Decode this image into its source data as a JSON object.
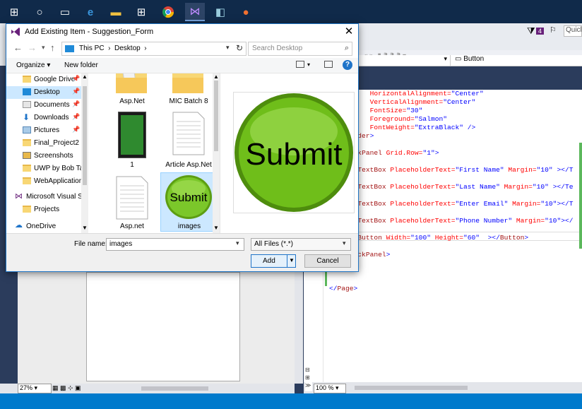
{
  "dialog": {
    "title": "Add Existing Item - Suggestion_Form",
    "close": "✕",
    "address": {
      "segments": "This PC  ›  Desktop  ›"
    },
    "search_placeholder": "Search Desktop",
    "toolbar": {
      "organize": "Organize ▾",
      "new_folder": "New folder",
      "help": "?"
    },
    "nav_items": [
      {
        "label": "Google Drive",
        "pin": "📌"
      },
      {
        "label": "Desktop",
        "pin": "📌"
      },
      {
        "label": "Documents",
        "pin": "📌"
      },
      {
        "label": "Downloads",
        "pin": "📌"
      },
      {
        "label": "Pictures",
        "pin": "📌"
      },
      {
        "label": "Final_Project2"
      },
      {
        "label": "Screenshots"
      },
      {
        "label": "UWP by Bob Tab"
      },
      {
        "label": "WebApplication"
      },
      {
        "label": "Microsoft Visual S"
      },
      {
        "label": "Projects"
      },
      {
        "label": "OneDrive"
      }
    ],
    "files": [
      {
        "name": "Asp.Net"
      },
      {
        "name": "MIC Batch 8"
      },
      {
        "name": "1"
      },
      {
        "name": "Article Asp.Net"
      },
      {
        "name": "Asp.net"
      },
      {
        "name": "images"
      }
    ],
    "thumb_text": "Submit",
    "preview_text": "Submit",
    "filename_label": "File name:",
    "filename_value": "images",
    "filetype_value": "All Files (*.*)",
    "add_label": "Add",
    "cancel_label": "Cancel"
  },
  "editor": {
    "dropdown_right": "Button",
    "quick": "Quick",
    "badge": "4",
    "zoom_left": "27%",
    "zoom_right": "100 %",
    "lines": [
      {
        "indent": "          ",
        "parts": [
          [
            "attr",
            "HorizontalAlignment="
          ],
          [
            "val",
            "\"Center\""
          ]
        ]
      },
      {
        "indent": "          ",
        "parts": [
          [
            "attr",
            "VerticalAlignment="
          ],
          [
            "val",
            "\"Center\""
          ]
        ]
      },
      {
        "indent": "          ",
        "parts": [
          [
            "attr",
            "FontSize="
          ],
          [
            "val",
            "\"30\""
          ]
        ]
      },
      {
        "indent": "          ",
        "parts": [
          [
            "attr",
            "Foreground="
          ],
          [
            "val",
            "\"Salmon\""
          ]
        ]
      },
      {
        "indent": "          ",
        "parts": [
          [
            "attr",
            "FontWeight="
          ],
          [
            "val",
            "\"ExtraBlack\""
          ],
          [
            "br",
            " />"
          ]
        ]
      },
      {
        "indent": "  ",
        "parts": [
          [
            "br",
            "</"
          ],
          [
            "tag",
            "Border"
          ],
          [
            "br",
            ">"
          ]
        ]
      },
      {
        "indent": "",
        "parts": []
      },
      {
        "indent": "  ",
        "parts": [
          [
            "br",
            "<"
          ],
          [
            "tag",
            "StackPanel"
          ],
          [
            "attr",
            " Grid.Row="
          ],
          [
            "val",
            "\"1\""
          ],
          [
            "br",
            ">"
          ]
        ]
      },
      {
        "indent": "",
        "parts": []
      },
      {
        "indent": "      ",
        "parts": [
          [
            "br",
            "<"
          ],
          [
            "tag",
            "TextBox"
          ],
          [
            "attr",
            " PlaceholderText="
          ],
          [
            "val",
            "\"First Name\""
          ],
          [
            "attr",
            " Margin="
          ],
          [
            "val",
            "\"10\""
          ],
          [
            "br",
            " ></T"
          ]
        ]
      },
      {
        "indent": "",
        "parts": []
      },
      {
        "indent": "      ",
        "parts": [
          [
            "br",
            "<"
          ],
          [
            "tag",
            "TextBox"
          ],
          [
            "attr",
            " PlaceholderText="
          ],
          [
            "val",
            "\"Last Name\""
          ],
          [
            "attr",
            " Margin="
          ],
          [
            "val",
            "\"10\""
          ],
          [
            "br",
            " ></Te"
          ]
        ]
      },
      {
        "indent": "",
        "parts": []
      },
      {
        "indent": "      ",
        "parts": [
          [
            "br",
            "<"
          ],
          [
            "tag",
            "TextBox"
          ],
          [
            "attr",
            " PlaceholderText="
          ],
          [
            "val",
            "\"Enter Email\""
          ],
          [
            "attr",
            " Margin="
          ],
          [
            "val",
            "\"10\""
          ],
          [
            "br",
            "></T"
          ]
        ]
      },
      {
        "indent": "",
        "parts": []
      },
      {
        "indent": "      ",
        "parts": [
          [
            "br",
            "<"
          ],
          [
            "tag",
            "TextBox"
          ],
          [
            "attr",
            " PlaceholderText="
          ],
          [
            "val",
            "\"Phone Number\""
          ],
          [
            "attr",
            " Margin="
          ],
          [
            "val",
            "\"10\""
          ],
          [
            "br",
            "></"
          ]
        ]
      },
      {
        "indent": "",
        "parts": []
      },
      {
        "indent": "      ",
        "parts": [
          [
            "br",
            "<"
          ],
          [
            "tag",
            "Button"
          ],
          [
            "attr",
            " Width="
          ],
          [
            "val",
            "\"100\""
          ],
          [
            "attr",
            " Height="
          ],
          [
            "val",
            "\"60\""
          ],
          [
            "br",
            "  ></"
          ],
          [
            "tag",
            "Button"
          ],
          [
            "br",
            ">"
          ]
        ]
      },
      {
        "indent": "",
        "parts": []
      },
      {
        "indent": "  ",
        "parts": [
          [
            "br",
            "</"
          ],
          [
            "tag",
            "StackPanel"
          ],
          [
            "br",
            ">"
          ]
        ]
      },
      {
        "indent": "",
        "parts": [
          [
            "tag",
            "rid"
          ],
          [
            "br",
            ">"
          ]
        ]
      },
      {
        "indent": "",
        "parts": []
      },
      {
        "indent": "",
        "parts": []
      },
      {
        "indent": "",
        "parts": [
          [
            "br",
            "</"
          ],
          [
            "tag",
            "Page"
          ],
          [
            "br",
            ">"
          ]
        ]
      }
    ]
  },
  "colors": {
    "taskbar": "#102a4a",
    "accent": "#007acc",
    "button_green": "#6fbe1a"
  }
}
